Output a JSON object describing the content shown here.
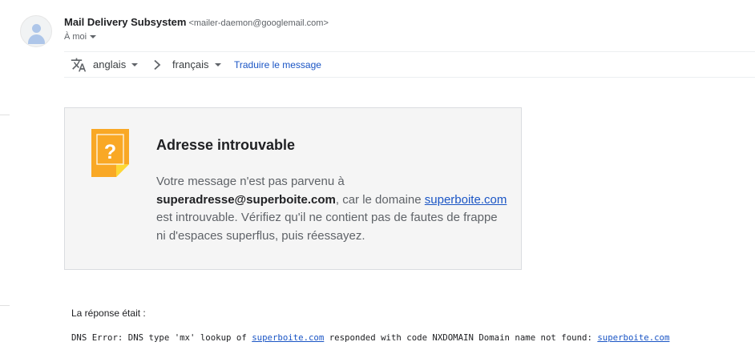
{
  "sender": {
    "name": "Mail Delivery Subsystem",
    "email": "<mailer-daemon@googlemail.com>"
  },
  "recipient": {
    "label": "À moi"
  },
  "translate": {
    "source_lang": "anglais",
    "target_lang": "français",
    "action": "Traduire le message"
  },
  "bounce": {
    "title": "Adresse introuvable",
    "line1": "Votre message n'est pas parvenu à",
    "address": "superadresse@superboite.com",
    "mid": ", car le domaine ",
    "domain": "superboite.com",
    "line3": "est introuvable. Vérifiez qu'il ne contient pas de fautes de frappe ni d'espaces superflus, puis réessayez.",
    "icon_color": "#f9a825"
  },
  "response": {
    "label": "La réponse était :",
    "part1": "DNS Error: DNS type 'mx' lookup of ",
    "domain1": "superboite.com",
    "part2": " responded with code NXDOMAIN Domain name not found: ",
    "domain2": "superboite.com"
  },
  "icons": [
    "avatar-icon",
    "translate-icon",
    "chevron-right-icon",
    "caret-down-icon",
    "question-note-icon"
  ]
}
